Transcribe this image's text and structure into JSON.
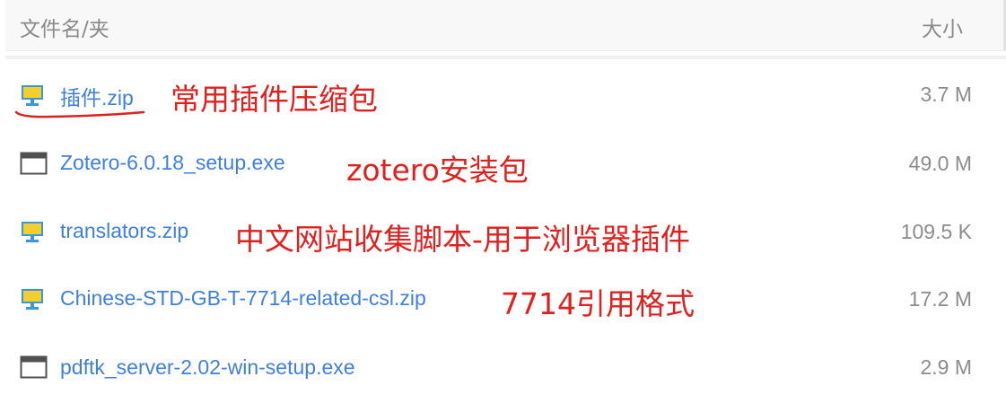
{
  "header": {
    "name_col": "文件名/夹",
    "size_col": "大小"
  },
  "files": [
    {
      "name": "插件.zip",
      "size": "3.7 M",
      "icon": "zip-archive-icon",
      "note": "常用插件压缩包"
    },
    {
      "name": "Zotero-6.0.18_setup.exe",
      "size": "49.0 M",
      "icon": "exe-application-icon",
      "note": "zotero安装包"
    },
    {
      "name": "translators.zip",
      "size": "109.5 K",
      "icon": "zip-archive-icon",
      "note": "中文网站收集脚本-用于浏览器插件"
    },
    {
      "name": "Chinese-STD-GB-T-7714-related-csl.zip",
      "size": "17.2 M",
      "icon": "zip-archive-icon",
      "note": "7714引用格式"
    },
    {
      "name": "pdftk_server-2.02-win-setup.exe",
      "size": "2.9 M",
      "icon": "exe-application-icon",
      "note": ""
    }
  ],
  "colors": {
    "link": "#3f7fe0",
    "annotation": "#e0201e",
    "muted": "#8c8c8c",
    "zip_icon_screen": "#f3cf2d",
    "zip_icon_frame": "#3a96dd"
  }
}
